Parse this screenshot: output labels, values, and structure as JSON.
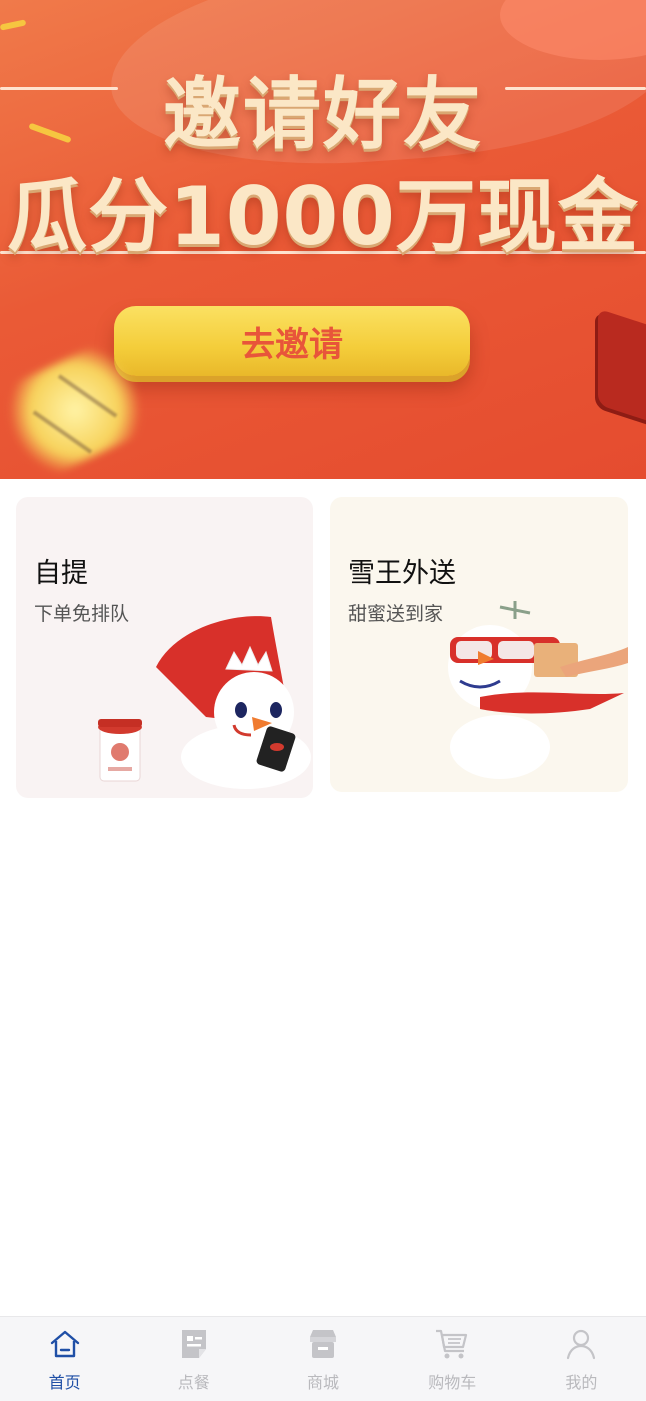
{
  "banner": {
    "headline": "邀请好友",
    "subheadline": "瓜分1000万现金",
    "invite_button": "去邀请"
  },
  "services": [
    {
      "title": "自提",
      "subtitle": "下单免排队"
    },
    {
      "title": "雪王外送",
      "subtitle": "甜蜜送到家"
    }
  ],
  "tabbar": {
    "active_color": "#1f4fa6",
    "inactive_color": "#b9b9bd",
    "tabs": [
      {
        "label": "首页",
        "icon": "home-icon",
        "active": true
      },
      {
        "label": "点餐",
        "icon": "menu-order-icon",
        "active": false
      },
      {
        "label": "商城",
        "icon": "store-icon",
        "active": false
      },
      {
        "label": "购物车",
        "icon": "cart-icon",
        "active": false
      },
      {
        "label": "我的",
        "icon": "profile-icon",
        "active": false
      }
    ]
  }
}
